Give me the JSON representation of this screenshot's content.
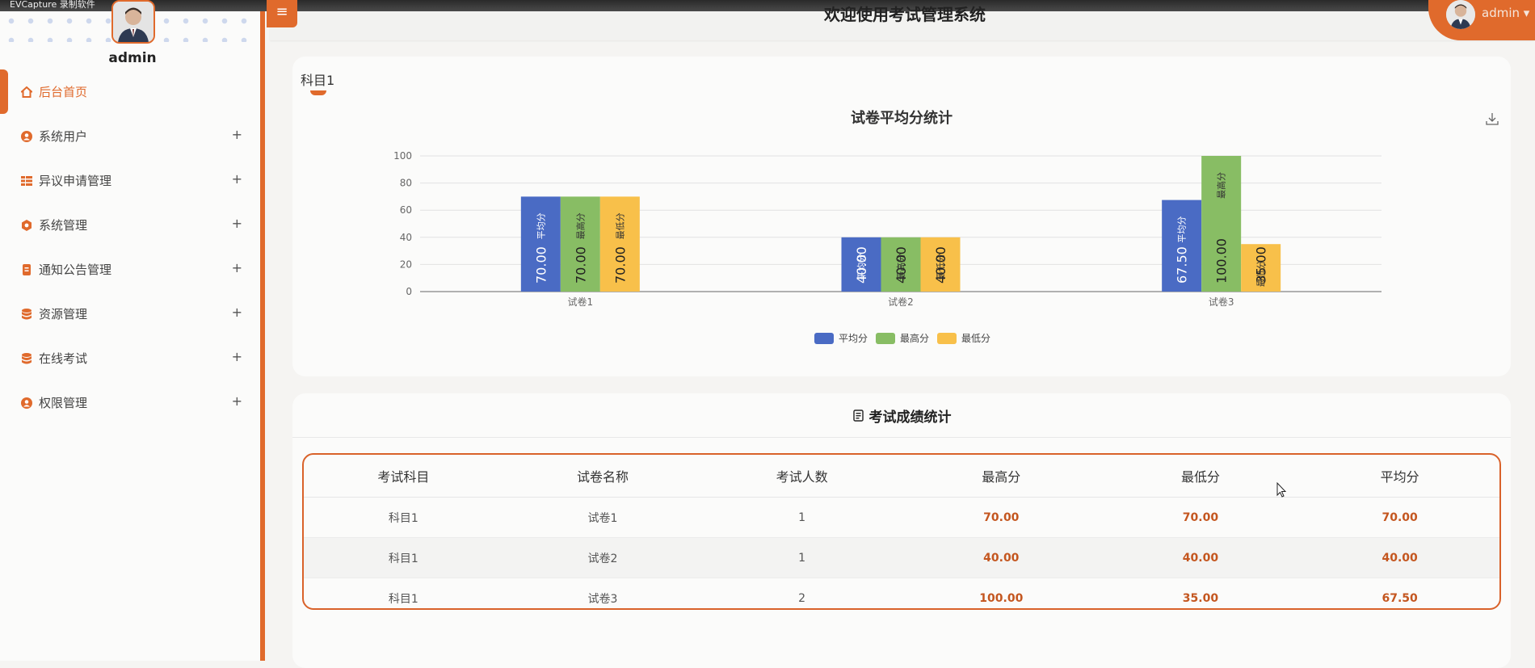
{
  "window": {
    "caption": "EVCapture 录制软件"
  },
  "app": {
    "title": "欢迎使用考试管理系统",
    "accent": "#e06a2c"
  },
  "user": {
    "name": "admin",
    "menu_label": "admin ▾"
  },
  "sidebar": {
    "items": [
      {
        "label": "后台首页",
        "icon": "home-icon",
        "active": true
      },
      {
        "label": "系统用户",
        "icon": "user-icon"
      },
      {
        "label": "异议申请管理",
        "icon": "grid-icon"
      },
      {
        "label": "系统管理",
        "icon": "settings-icon"
      },
      {
        "label": "通知公告管理",
        "icon": "document-icon"
      },
      {
        "label": "资源管理",
        "icon": "database-icon"
      },
      {
        "label": "在线考试",
        "icon": "database-icon"
      },
      {
        "label": "权限管理",
        "icon": "user-icon"
      }
    ],
    "expand_symbol": "+"
  },
  "tabs": [
    {
      "label": "科目1",
      "active": true
    }
  ],
  "chart_data": {
    "type": "bar",
    "title": "试卷平均分统计",
    "categories": [
      "试卷1",
      "试卷2",
      "试卷3"
    ],
    "series": [
      {
        "name": "平均分",
        "values": [
          70,
          40,
          67.5
        ],
        "color": "#4a6bc4"
      },
      {
        "name": "最高分",
        "values": [
          70,
          40,
          100
        ],
        "color": "#88bd64"
      },
      {
        "name": "最低分",
        "values": [
          70,
          40,
          35
        ],
        "color": "#f8c04a"
      }
    ],
    "yticks": [
      0,
      20,
      40,
      60,
      80,
      100
    ],
    "ylim": [
      0,
      100
    ],
    "grid": true,
    "legend": "bottom",
    "value_labels": [
      [
        "70.00",
        "70.00",
        "70.00"
      ],
      [
        "40.00",
        "40.00",
        "40.00"
      ],
      [
        "67.50",
        "100.00",
        "35.00"
      ]
    ]
  },
  "stats": {
    "title": "考试成绩统计",
    "columns": [
      "考试科目",
      "试卷名称",
      "考试人数",
      "最高分",
      "最低分",
      "平均分"
    ],
    "rows": [
      [
        "科目1",
        "试卷1",
        "1",
        "70.00",
        "70.00",
        "70.00"
      ],
      [
        "科目1",
        "试卷2",
        "1",
        "40.00",
        "40.00",
        "40.00"
      ],
      [
        "科目1",
        "试卷3",
        "2",
        "100.00",
        "35.00",
        "67.50"
      ]
    ]
  }
}
